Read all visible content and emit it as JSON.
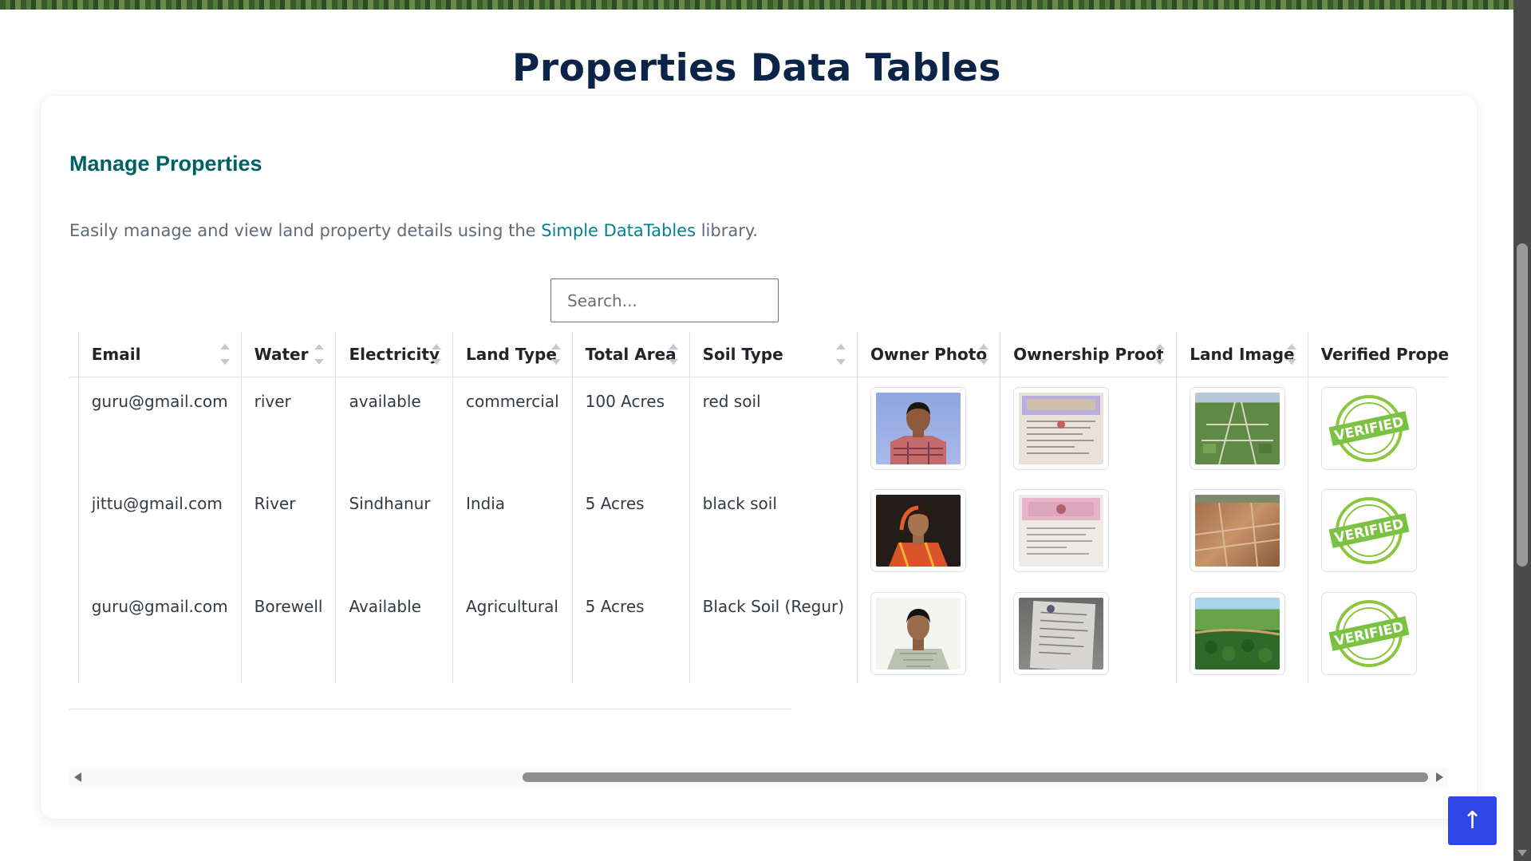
{
  "page_title": "Properties Data Tables",
  "card": {
    "title": "Manage Properties",
    "desc_before": "Easily manage and view land property details using the ",
    "desc_link": "Simple DataTables",
    "desc_after": " library."
  },
  "search": {
    "placeholder": "Search..."
  },
  "table": {
    "headers": {
      "email": "Email",
      "water": "Water",
      "electricity": "Electricity",
      "land_type": "Land Type",
      "total_area": "Total Area",
      "soil_type": "Soil Type",
      "owner_photo": "Owner Photo",
      "ownership_proof": "Ownership Proof",
      "land_image": "Land Image",
      "verified_property": "Verified Property"
    },
    "rows": [
      {
        "id": "3",
        "email": "guru@gmail.com",
        "water": "river",
        "electricity": "available",
        "land_type": "commercial",
        "total_area": "100 Acres",
        "soil_type": "red soil",
        "verified_stamp": "VERIFIED"
      },
      {
        "id": "3",
        "email": "jittu@gmail.com",
        "water": "River",
        "electricity": "Sindhanur",
        "land_type": "India",
        "total_area": "5 Acres",
        "soil_type": "black soil",
        "verified_stamp": "VERIFIED"
      },
      {
        "id": "2",
        "email": "guru@gmail.com",
        "water": "Borewell",
        "electricity": "Available",
        "land_type": "Agricultural",
        "total_area": "5 Acres",
        "soil_type": "Black Soil (Regur)",
        "verified_stamp": "VERIFIED"
      }
    ]
  },
  "back_to_top": {
    "icon": "arrow-up-icon",
    "glyph": "↑"
  },
  "colors": {
    "title": "#0b2447",
    "accent": "#006064",
    "link": "#00838f",
    "button": "#2f47e6",
    "stamp": "#7cc242"
  }
}
